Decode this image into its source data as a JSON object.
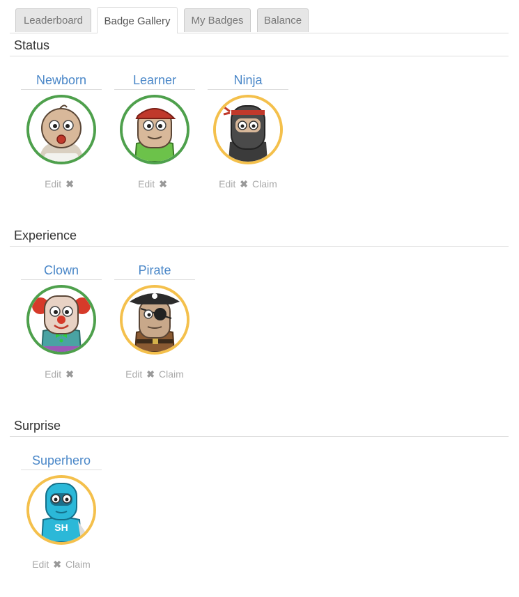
{
  "tabs": [
    {
      "label": "Leaderboard",
      "active": false
    },
    {
      "label": "Badge Gallery",
      "active": true
    },
    {
      "label": "My Badges",
      "active": false
    },
    {
      "label": "Balance",
      "active": false
    }
  ],
  "sections": [
    {
      "title": "Status",
      "badges": [
        {
          "name": "Newborn",
          "ring": "green",
          "icon": "newborn-avatar-icon",
          "actions": {
            "edit": "Edit",
            "remove": "✖"
          }
        },
        {
          "name": "Learner",
          "ring": "green",
          "icon": "learner-avatar-icon",
          "actions": {
            "edit": "Edit",
            "remove": "✖"
          }
        },
        {
          "name": "Ninja",
          "ring": "gold",
          "icon": "ninja-avatar-icon",
          "actions": {
            "edit": "Edit",
            "remove": "✖",
            "claim": "Claim"
          }
        }
      ]
    },
    {
      "title": "Experience",
      "badges": [
        {
          "name": "Clown",
          "ring": "green",
          "icon": "clown-avatar-icon",
          "actions": {
            "edit": "Edit",
            "remove": "✖"
          }
        },
        {
          "name": "Pirate",
          "ring": "gold",
          "icon": "pirate-avatar-icon",
          "actions": {
            "edit": "Edit",
            "remove": "✖",
            "claim": "Claim"
          }
        }
      ]
    },
    {
      "title": "Surprise",
      "badges": [
        {
          "name": "Superhero",
          "ring": "gold",
          "icon": "superhero-avatar-icon",
          "shirt_text": "SH",
          "actions": {
            "edit": "Edit",
            "remove": "✖",
            "claim": "Claim"
          }
        }
      ]
    }
  ],
  "colors": {
    "link": "#4a87c8",
    "ring_earned": "#4ea04c",
    "ring_unclaimed": "#f4c04c",
    "action_text": "#aaaaaa"
  }
}
